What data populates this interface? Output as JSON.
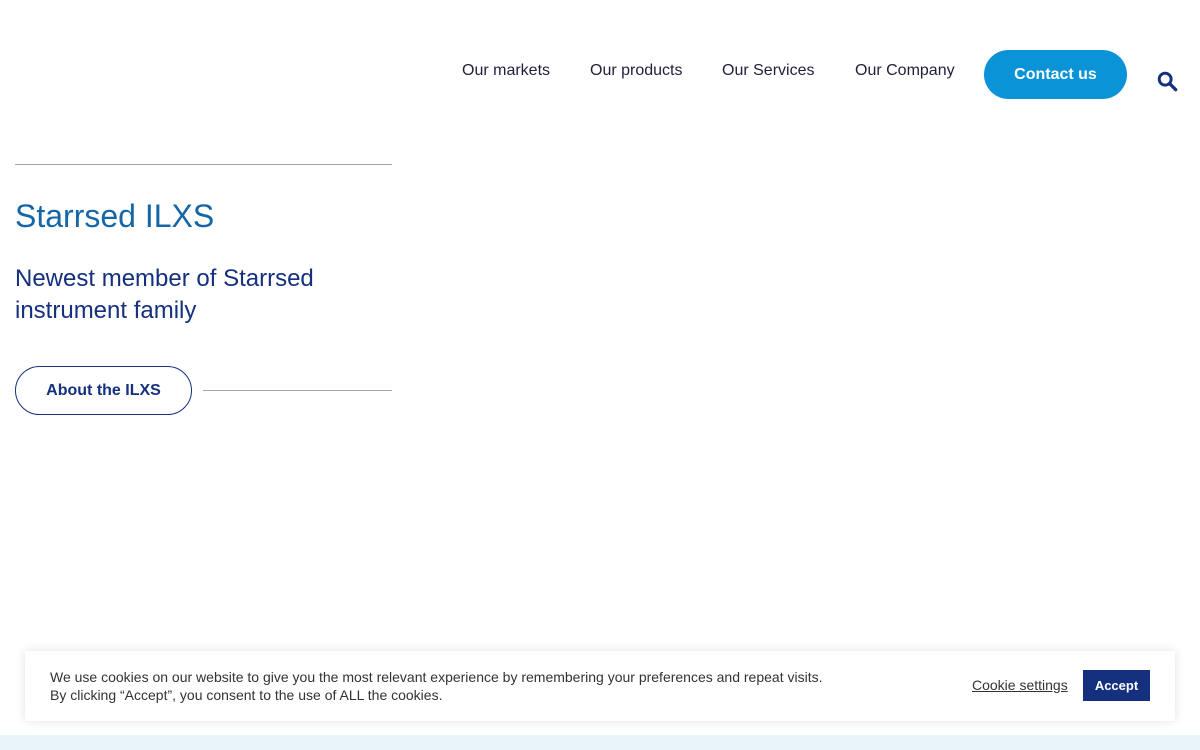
{
  "nav": {
    "items": [
      {
        "label": "Our markets"
      },
      {
        "label": "Our products"
      },
      {
        "label": "Our Services"
      },
      {
        "label": "Our Company"
      }
    ],
    "contact_label": "Contact us",
    "search_icon": "search-icon"
  },
  "hero": {
    "title": "Starrsed ILXS",
    "subtitle": "Newest member of Starrsed instrument family",
    "cta_label": "About the ILXS"
  },
  "cookie": {
    "text": "We use cookies on our website to give you the most relevant experience by remembering your preferences and repeat visits. By clicking “Accept”, you consent to the use of ALL the cookies.",
    "settings_label": "Cookie settings",
    "accept_label": "Accept"
  },
  "colors": {
    "accent": "#0a93d6",
    "brand_dark": "#14307e",
    "title_blue": "#1466a6"
  }
}
